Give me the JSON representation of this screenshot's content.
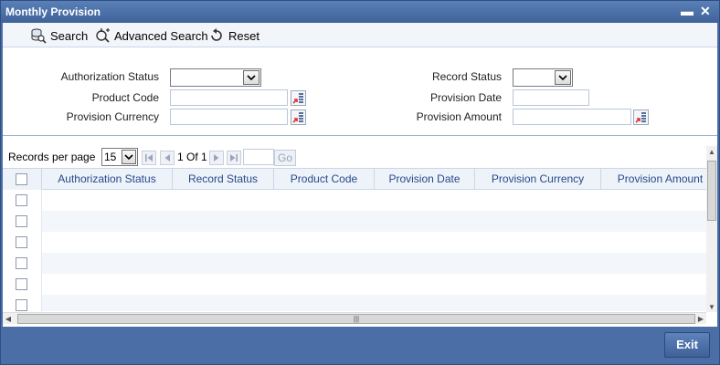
{
  "window": {
    "title": "Monthly Provision",
    "minimize_glyph": "▬",
    "close_glyph": "✕"
  },
  "toolbar": {
    "search_label": "Search",
    "advanced_search_label": "Advanced Search",
    "reset_label": "Reset"
  },
  "search_form": {
    "authorization_status": {
      "label": "Authorization Status",
      "value": ""
    },
    "record_status": {
      "label": "Record Status",
      "value": ""
    },
    "product_code": {
      "label": "Product Code",
      "value": ""
    },
    "provision_date": {
      "label": "Provision Date",
      "value": ""
    },
    "provision_currency": {
      "label": "Provision Currency",
      "value": ""
    },
    "provision_amount": {
      "label": "Provision Amount",
      "value": ""
    }
  },
  "pager": {
    "records_per_page_label": "Records per page",
    "records_per_page_value": "15",
    "page_info": "1 Of 1",
    "go_label": "Go"
  },
  "grid": {
    "columns": [
      "Authorization Status",
      "Record Status",
      "Product Code",
      "Provision Date",
      "Provision Currency",
      "Provision Amount"
    ],
    "row_count": 6
  },
  "footer": {
    "exit_label": "Exit"
  },
  "icons": {
    "search": "search-icon",
    "advanced_search": "advanced-search-icon",
    "reset": "reset-icon",
    "lov": "list-of-values-icon"
  }
}
